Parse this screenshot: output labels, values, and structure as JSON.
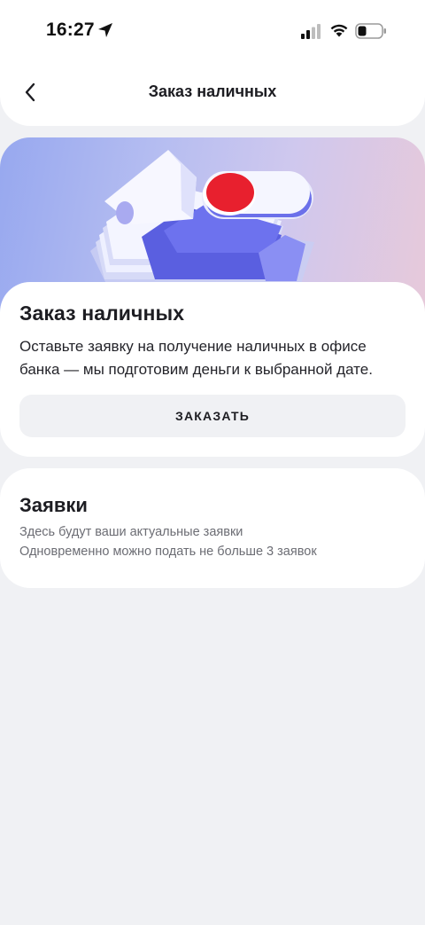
{
  "status_bar": {
    "time": "16:27",
    "icons": [
      "location-arrow-icon",
      "cellular-signal-icon",
      "wifi-icon",
      "battery-icon"
    ]
  },
  "nav": {
    "back_icon": "chevron-left-icon",
    "title": "Заказ наличных"
  },
  "hero": {
    "illustration": "banknotes-toggle-illustration"
  },
  "order_card": {
    "title": "Заказ наличных",
    "description": "Оставьте заявку на получение наличных в офисе банка — мы подготовим деньги к выбранной дате.",
    "button_label": "ЗАКАЗАТЬ"
  },
  "requests_card": {
    "title": "Заявки",
    "lines": [
      "Здесь будут ваши актуальные заявки",
      "Одновременно можно подать не больше 3 заявок"
    ]
  },
  "colors": {
    "background": "#f0f1f4",
    "card": "#ffffff",
    "text_primary": "#1d1d22",
    "text_secondary": "#6c6d74",
    "accent_red": "#e8202e",
    "hero_gradient_start": "#97a8ef",
    "hero_gradient_end": "#e7c9da"
  }
}
